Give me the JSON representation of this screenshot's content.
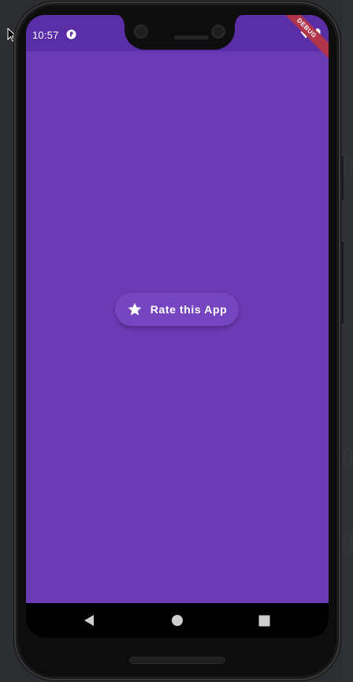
{
  "status_bar": {
    "time": "10:57",
    "icons": [
      "app-notification-icon",
      "wifi-icon",
      "battery-icon"
    ]
  },
  "debug_banner": {
    "label": "DEBUG"
  },
  "main": {
    "rate_button": {
      "label": "Rate this App",
      "icon": "star-icon"
    }
  },
  "nav_bar": {
    "buttons": [
      "back-icon",
      "home-icon",
      "recents-icon"
    ]
  },
  "colors": {
    "app_background": "#6b3bb6",
    "status_bar": "#5a2ea6",
    "button_background": "#7645c0",
    "debug_banner": "#b0344a",
    "nav_bar": "#000000"
  }
}
